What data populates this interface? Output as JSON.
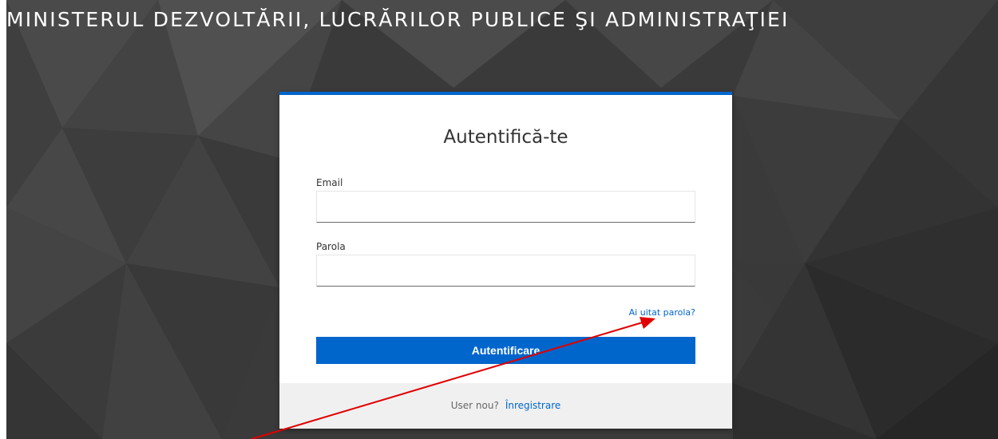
{
  "header": {
    "title": "MINISTERUL DEZVOLTĂRII, LUCRĂRILOR PUBLICE ŞI ADMINISTRAŢIEI"
  },
  "login_form": {
    "title": "Autentifică-te",
    "email_label": "Email",
    "email_value": "",
    "password_label": "Parola",
    "password_value": "",
    "forgot_password_link": "Ai uitat parola?",
    "submit_label": "Autentificare"
  },
  "footer": {
    "prompt": "User nou?",
    "register_link": "Înregistrare"
  },
  "colors": {
    "accent": "#0066cc",
    "background": "#3a3a3a",
    "footer_bg": "#f0f0f0",
    "annotation_arrow": "#e00000"
  }
}
